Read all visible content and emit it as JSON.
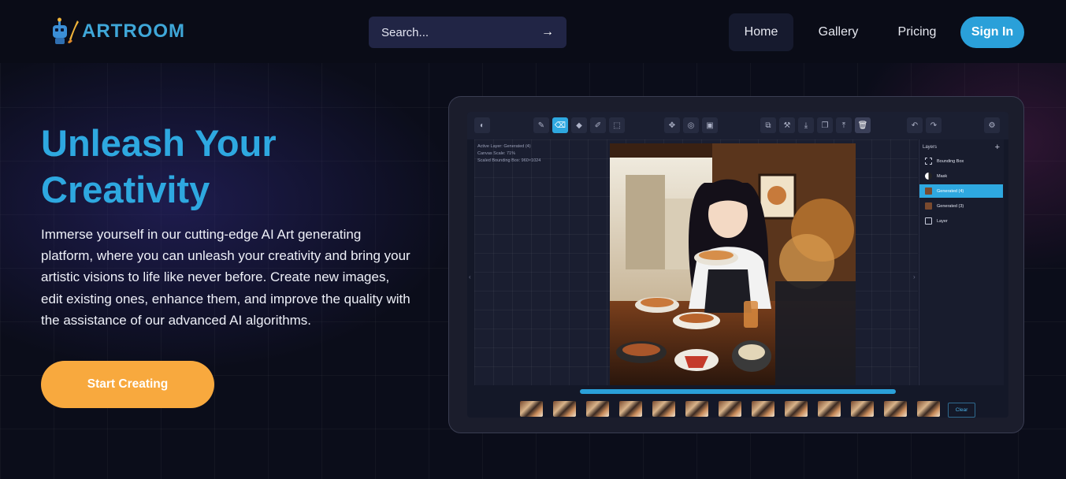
{
  "brand": {
    "name": "ARTROOM",
    "accent": "#3fa7d8"
  },
  "search": {
    "placeholder": "Search...",
    "submit_icon": "arrow-right-icon"
  },
  "nav": {
    "items": [
      {
        "label": "Home",
        "active": true
      },
      {
        "label": "Gallery"
      },
      {
        "label": "Pricing"
      }
    ],
    "signin_label": "Sign In"
  },
  "hero": {
    "title_line1": "Unleash Your",
    "title_line2": "Creativity",
    "description": "Immerse yourself in our cutting-edge AI Art generating platform, where you can unleash your creativity and bring your artistic visions to life like never before. Create new images, edit existing ones, enhance them, and improve the quality with the assistance of our advanced AI algorithms.",
    "cta_label": "Start Creating",
    "cta_color": "#f8a93e"
  },
  "preview": {
    "canvas_info": [
      "Active Layer: Generated (4)",
      "Canvas Scale: 71%",
      "Scaled Bounding Box: 960×1024"
    ],
    "layers_title": "Layers",
    "layers": [
      {
        "label": "Bounding Box",
        "icon": "bounding-box-icon"
      },
      {
        "label": "Mask",
        "icon": "mask-icon"
      },
      {
        "label": "Generated (4)",
        "icon": "image-thumb-icon",
        "active": true
      },
      {
        "label": "Generated (3)",
        "icon": "image-thumb-icon"
      },
      {
        "label": "Layer",
        "icon": "image-icon"
      }
    ],
    "clear_label": "Clear",
    "progress": 1.0
  },
  "colors": {
    "primary": "#2aa0d9",
    "background": "#0b0d1a"
  }
}
